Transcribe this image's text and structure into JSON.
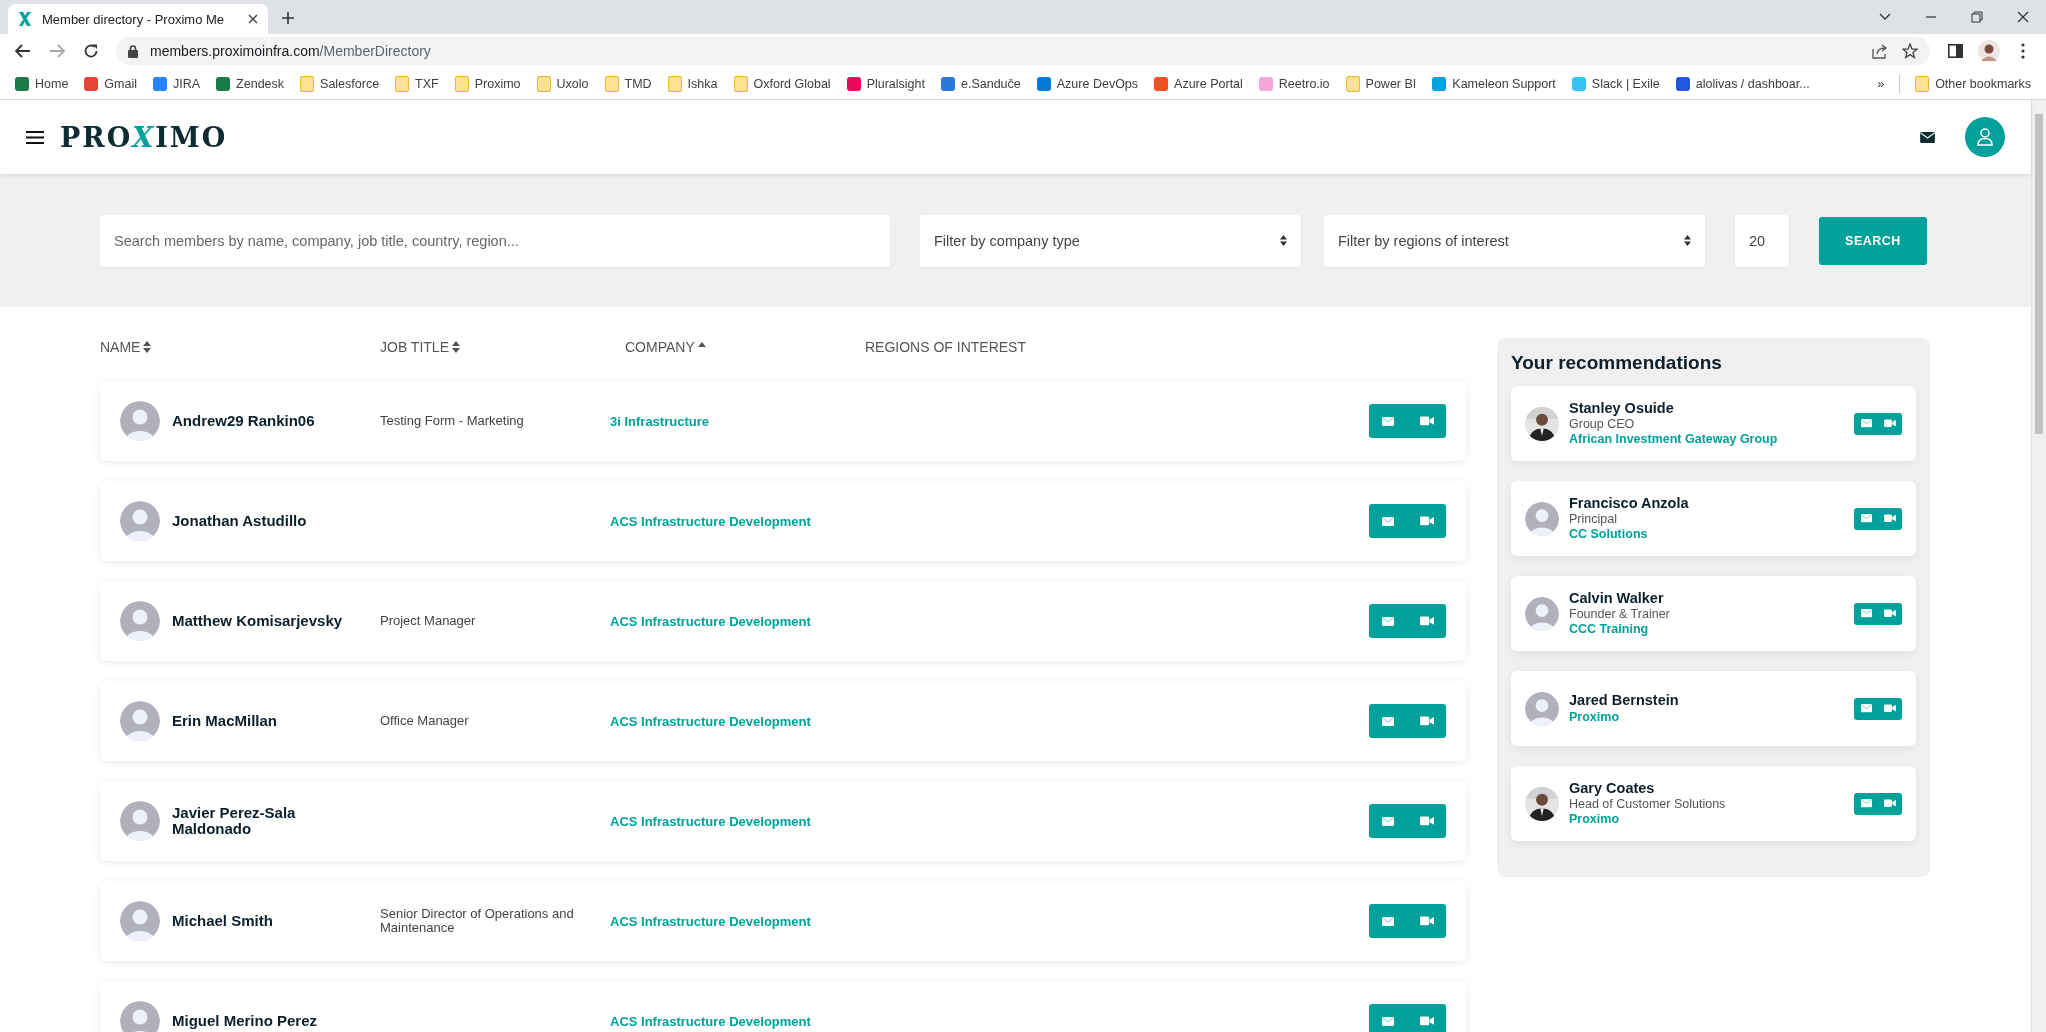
{
  "browser": {
    "tab_title": "Member directory - Proximo Me",
    "url_host": "members.proximoinfra.com",
    "url_path": "/MemberDirectory",
    "bookmarks": [
      {
        "label": "Home",
        "kind": "site",
        "color": "#1a7a4c"
      },
      {
        "label": "Gmail",
        "kind": "site",
        "color": "#ea4335"
      },
      {
        "label": "JIRA",
        "kind": "site",
        "color": "#2684ff"
      },
      {
        "label": "Zendesk",
        "kind": "site",
        "color": "#1a7a4c"
      },
      {
        "label": "Salesforce",
        "kind": "folder"
      },
      {
        "label": "TXF",
        "kind": "folder"
      },
      {
        "label": "Proximo",
        "kind": "folder"
      },
      {
        "label": "Uxolo",
        "kind": "folder"
      },
      {
        "label": "TMD",
        "kind": "folder"
      },
      {
        "label": "Ishka",
        "kind": "folder"
      },
      {
        "label": "Oxford Global",
        "kind": "folder"
      },
      {
        "label": "Pluralsight",
        "kind": "site",
        "color": "#e80a5b"
      },
      {
        "label": "e.Sanduče",
        "kind": "site",
        "color": "#2a7bd8"
      },
      {
        "label": "Azure DevOps",
        "kind": "site",
        "color": "#0078d4"
      },
      {
        "label": "Azure Portal",
        "kind": "site",
        "color": "#f25022"
      },
      {
        "label": "Reetro.io",
        "kind": "site",
        "color": "#f4a6d7"
      },
      {
        "label": "Power BI",
        "kind": "folder"
      },
      {
        "label": "Kameleon Support",
        "kind": "site",
        "color": "#00a1e0"
      },
      {
        "label": "Slack | Exile",
        "kind": "site",
        "color": "#36c5f0"
      },
      {
        "label": "alolivas / dashboar...",
        "kind": "site",
        "color": "#2456e8"
      }
    ],
    "overflow": "»",
    "other_bookmarks": "Other bookmarks"
  },
  "header": {
    "logo": {
      "before": "PRO",
      "accent": "X",
      "after": "IMO"
    }
  },
  "filters": {
    "search": {
      "placeholder": "Search members by name, company, job title, country, region..."
    },
    "company_type": "Filter by company type",
    "regions": "Filter by regions of interest",
    "page_size": "20",
    "search_button": "SEARCH"
  },
  "table": {
    "columns": [
      {
        "label": "NAME",
        "sortable": true,
        "sorted": false
      },
      {
        "label": "JOB TITLE",
        "sortable": true,
        "sorted": false
      },
      {
        "label": "COMPANY",
        "sortable": true,
        "sorted": true
      },
      {
        "label": "REGIONS OF INTEREST",
        "sortable": false,
        "sorted": false
      }
    ],
    "rows": [
      {
        "name": "Andrew29 Rankin06",
        "job_title": "Testing Form - Marketing",
        "company": "3i Infrastructure"
      },
      {
        "name": "Jonathan Astudillo",
        "company": "ACS Infrastructure Development"
      },
      {
        "name": "Matthew Komisarjevsky",
        "job_title": "Project Manager",
        "company": "ACS Infrastructure Development"
      },
      {
        "name": "Erin MacMillan",
        "job_title": "Office Manager",
        "company": "ACS Infrastructure Development"
      },
      {
        "name": "Javier Perez-Sala Maldonado",
        "company": "ACS Infrastructure Development"
      },
      {
        "name": "Michael Smith",
        "job_title": "Senior Director of Operations and Maintenance",
        "company": "ACS Infrastructure Development"
      },
      {
        "name": "Miguel Merino Perez",
        "company": "ACS Infrastructure Development"
      }
    ]
  },
  "recommendations": {
    "title": "Your recommendations",
    "items": [
      {
        "name": "Stanley Osuide",
        "role": "Group CEO",
        "company": "African Investment Gateway Group"
      },
      {
        "name": "Francisco Anzola",
        "role": "Principal",
        "company": "CC Solutions",
        "kind": "placeholder"
      },
      {
        "name": "Calvin Walker",
        "role": "Founder & Trainer",
        "company": "CCC Training",
        "kind": "placeholder"
      },
      {
        "name": "Jared Bernstein",
        "company": "Proximo",
        "kind": "placeholder"
      },
      {
        "name": "Gary Coates",
        "role": "Head of Customer Solutions",
        "company": "Proximo"
      }
    ]
  }
}
